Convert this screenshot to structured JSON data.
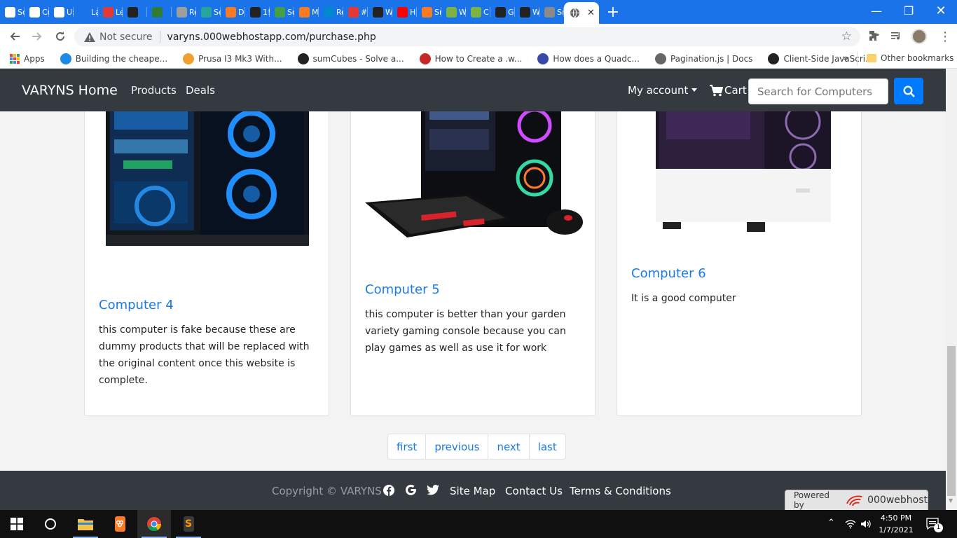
{
  "browser": {
    "tabs": [
      {
        "label": "Sc",
        "icon": "bar-chart-icon",
        "color": "#ffffff"
      },
      {
        "label": "Cr",
        "icon": "bar-chart-icon",
        "color": "#ffffff"
      },
      {
        "label": "U:",
        "icon": "bar-chart-icon",
        "color": "#ffffff"
      },
      {
        "label": "La",
        "icon": "f-logo-icon",
        "color": "#1a73e8"
      },
      {
        "label": "Le",
        "icon": "ring-icon",
        "color": "#e53935"
      },
      {
        "label": "",
        "icon": "code-icon",
        "color": "#222222"
      },
      {
        "label": "",
        "icon": "check-icon",
        "color": "#2e7d32"
      },
      {
        "label": "Re",
        "icon": "avatar-icon",
        "color": "#9e9e9e"
      },
      {
        "label": "Se",
        "icon": "chat-icon",
        "color": "#26a69a"
      },
      {
        "label": "D",
        "icon": "xampp-icon",
        "color": "#fb7a24"
      },
      {
        "label": "1!",
        "icon": "wix-icon",
        "color": "#222222"
      },
      {
        "label": "Sc",
        "icon": "chart-green-icon",
        "color": "#43a047"
      },
      {
        "label": "M",
        "icon": "xampp-icon",
        "color": "#fb7a24"
      },
      {
        "label": "Re",
        "icon": "react-icon",
        "color": "#0288d1"
      },
      {
        "label": "#",
        "icon": "notify-icon",
        "color": "#e53935"
      },
      {
        "label": "W",
        "icon": "chat-icon",
        "color": "#222222"
      },
      {
        "label": "H",
        "icon": "youtube-icon",
        "color": "#ff0000"
      },
      {
        "label": "Sr",
        "icon": "xampp-icon",
        "color": "#fb7a24"
      },
      {
        "label": "W",
        "icon": "webhost-icon",
        "color": "#7cb342"
      },
      {
        "label": "C",
        "icon": "webhost-icon",
        "color": "#7cb342"
      },
      {
        "label": "G",
        "icon": "github-icon",
        "color": "#222222"
      },
      {
        "label": "W",
        "icon": "github-icon",
        "color": "#222222"
      },
      {
        "label": "Sr",
        "icon": "globe-icon",
        "color": "#8a8a8a"
      }
    ],
    "active_tab": {
      "label": "",
      "icon": "globe-icon"
    },
    "new_tab_symbol": "+",
    "address": {
      "security": "Not secure",
      "url": "varyns.000webhostapp.com/purchase.php"
    },
    "bookmarks": [
      {
        "label": "Apps",
        "icon": "apps-grid-icon"
      },
      {
        "label": "Building the cheape...",
        "icon": "diamond-icon",
        "color": "#1e88e5"
      },
      {
        "label": "Prusa I3 Mk3 With...",
        "icon": "person-icon",
        "color": "#f0a030"
      },
      {
        "label": "sumCubes - Solve a...",
        "icon": "dice-icon",
        "color": "#222222"
      },
      {
        "label": "How to Create a .w...",
        "icon": "arrow-icon",
        "color": "#c62828"
      },
      {
        "label": "How does a Quadc...",
        "icon": "drone-icon",
        "color": "#3949ab"
      },
      {
        "label": "Pagination.js | Docs",
        "icon": "globe-icon",
        "color": "#666666"
      },
      {
        "label": "Client-Side JavaScri...",
        "icon": "js-icon",
        "color": "#222222"
      }
    ],
    "bookmarks_overflow": "»",
    "other_bookmarks": "Other bookmarks"
  },
  "site": {
    "brand": "VARYNS Home",
    "nav": [
      "Products",
      "Deals"
    ],
    "account": "My account",
    "cart": "Cart",
    "search_placeholder": "Search for Computers"
  },
  "products": [
    {
      "title": "Computer 4",
      "description": "this computer is fake because these are dummy products that will be replaced with the original content once this website is complete."
    },
    {
      "title": "Computer 5",
      "description": "this computer is better than your garden variety gaming console because you can play games as well as use it for work"
    },
    {
      "title": "Computer 6",
      "description": "It is a good computer"
    }
  ],
  "pagination": [
    "first",
    "previous",
    "next",
    "last"
  ],
  "footer": {
    "copyright": "Copyright © VARYNS",
    "links": [
      "Site Map",
      "Contact Us",
      "Terms & Conditions"
    ],
    "powered_prefix": "Powered by",
    "powered_brand": "000webhost"
  },
  "taskbar": {
    "time": "4:50 PM",
    "date": "1/7/2021",
    "notifications": "1"
  }
}
